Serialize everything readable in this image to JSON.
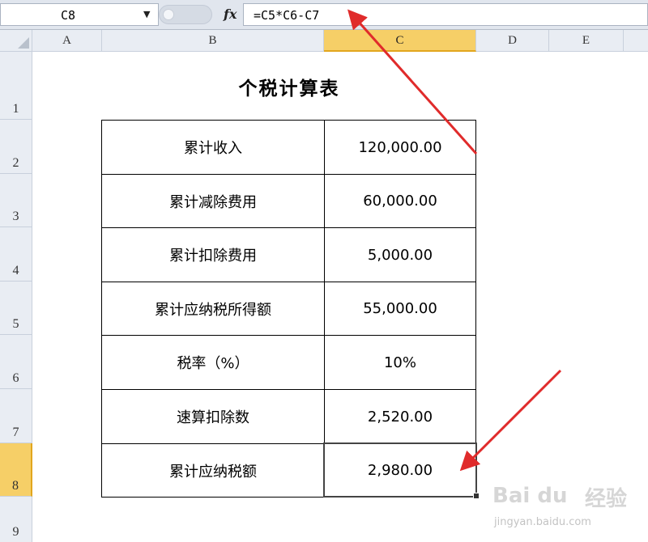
{
  "formula_bar": {
    "name_box": "C8",
    "fx_label": "fx",
    "formula": "=C5*C6-C7"
  },
  "columns": [
    "A",
    "B",
    "C",
    "D",
    "E"
  ],
  "rows": [
    "1",
    "2",
    "3",
    "4",
    "5",
    "6",
    "7",
    "8",
    "9"
  ],
  "selected": {
    "column": "C",
    "row": "8"
  },
  "sheet": {
    "title": "个税计算表",
    "table": [
      {
        "label": "累计收入",
        "value": "120,000.00"
      },
      {
        "label": "累计减除费用",
        "value": "60,000.00"
      },
      {
        "label": "累计扣除费用",
        "value": "5,000.00"
      },
      {
        "label": "累计应纳税所得额",
        "value": "55,000.00"
      },
      {
        "label": "税率（%）",
        "value": "10%"
      },
      {
        "label": "速算扣除数",
        "value": "2,520.00"
      },
      {
        "label": "累计应纳税额",
        "value": "2,980.00"
      }
    ]
  },
  "annotation_color": "#e02b2b",
  "selection_color": "#f6cf67",
  "watermark": {
    "brand": "Bai du",
    "subbrand": "经验",
    "url": "jingyan.baidu.com"
  }
}
